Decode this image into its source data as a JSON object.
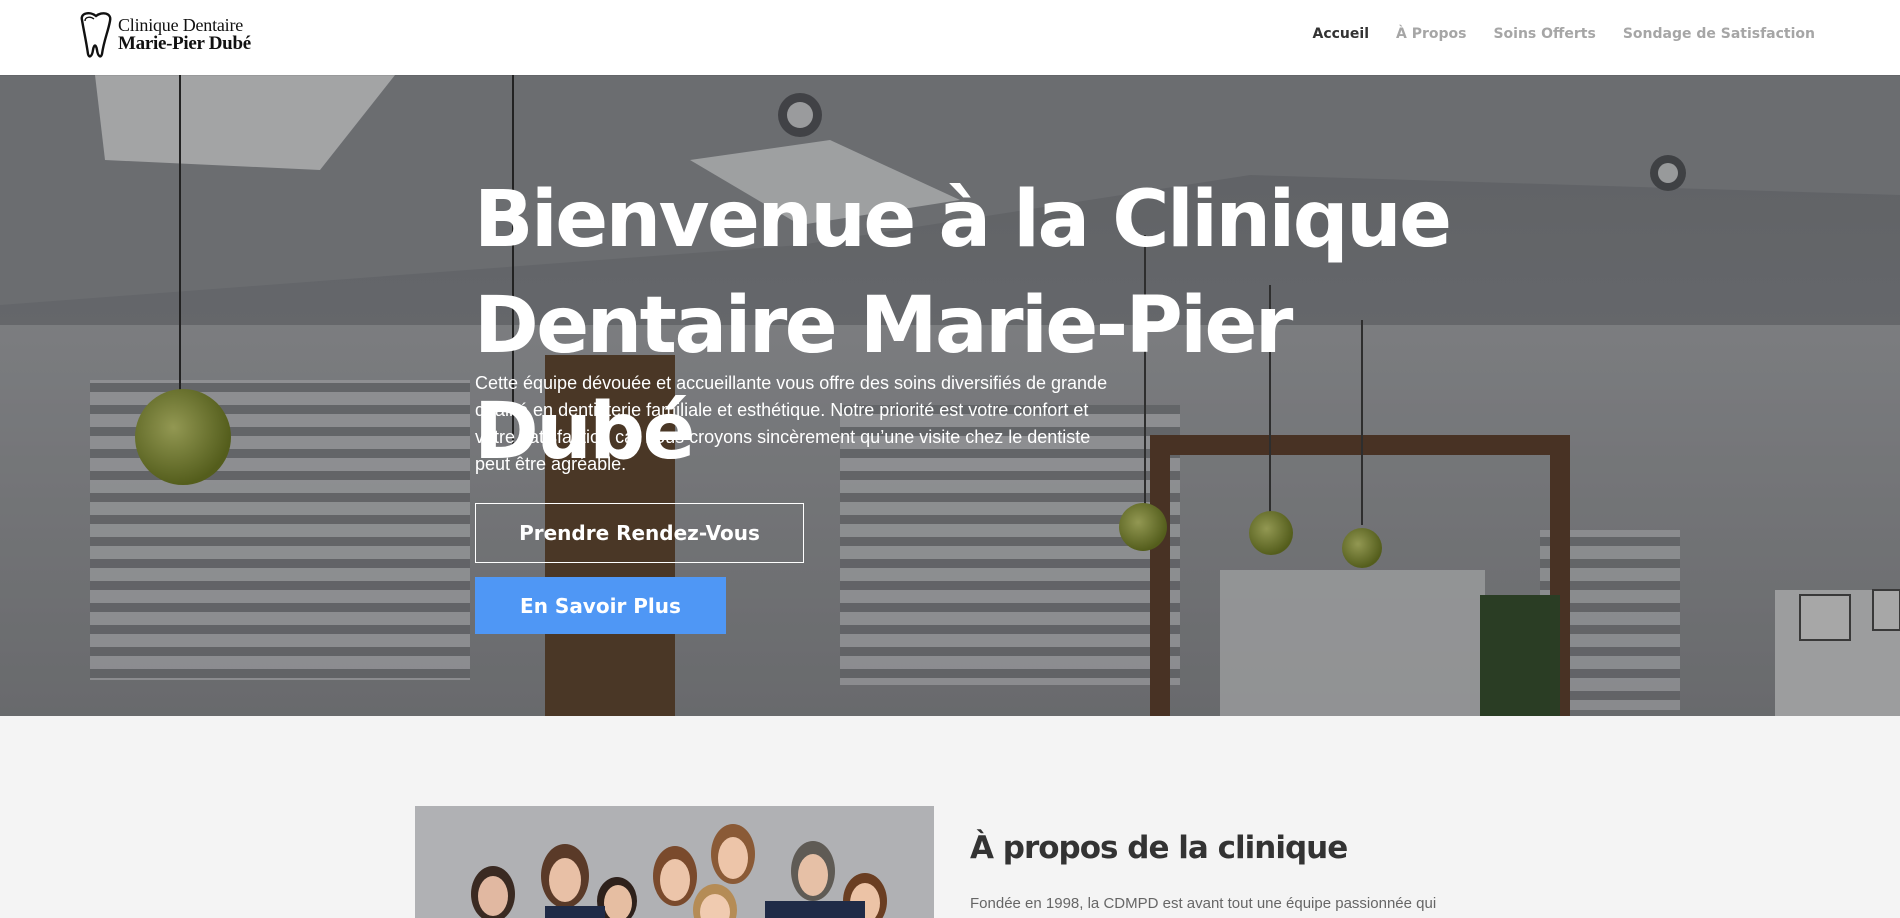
{
  "header": {
    "logo": {
      "line1": "Clinique Dentaire",
      "line2": "Marie-Pier Dubé"
    },
    "nav": [
      {
        "label": "Accueil",
        "active": true
      },
      {
        "label": "À Propos",
        "active": false
      },
      {
        "label": "Soins Offerts",
        "active": false
      },
      {
        "label": "Sondage de Satisfaction",
        "active": false
      }
    ]
  },
  "hero": {
    "title": "Bienvenue à la Clinique Dentaire Marie-Pier Dubé",
    "text": "Cette équipe dévouée et accueillante vous offre des soins diversifiés de grande qualité en dentisterie familiale et esthétique. Notre priorité est votre confort et votre satisfaction car nous croyons sincèrement qu’une visite chez le dentiste peut être agréable.",
    "button_primary_label": "Prendre Rendez-Vous",
    "button_secondary_label": "En Savoir Plus"
  },
  "about": {
    "title": "À propos de la clinique",
    "text": "Fondée en 1998, la CDMPD est avant tout une équipe passionnée qui"
  },
  "colors": {
    "accent": "#4f97f5",
    "nav_active": "#333333",
    "nav_inactive": "#a6a6a6",
    "section_bg": "#f4f4f4"
  }
}
